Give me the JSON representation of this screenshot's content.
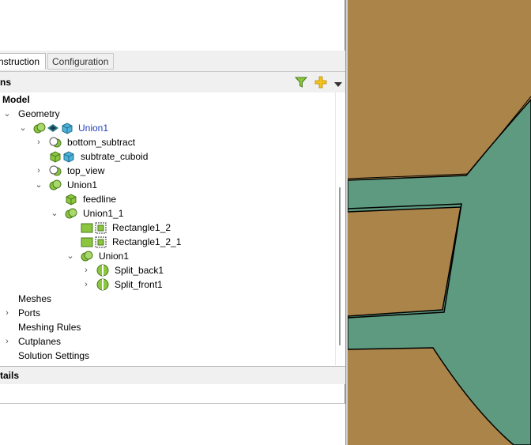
{
  "tabs": [
    {
      "label": "nstruction",
      "active": true
    },
    {
      "label": "Configuration",
      "active": false
    }
  ],
  "tree_header": {
    "label": "ns"
  },
  "tree": {
    "model": "Model",
    "geometry": "Geometry",
    "union1_top": "Union1",
    "bottom_subtract": "bottom_subtract",
    "subtrate_cuboid": "subtrate_cuboid",
    "top_view": "top_view",
    "union1": "Union1",
    "feedline": "feedline",
    "union1_1": "Union1_1",
    "rectangle1_2": "Rectangle1_2",
    "rectangle1_2_1": "Rectangle1_2_1",
    "union1_inner": "Union1",
    "split_back1": "Split_back1",
    "split_front1": "Split_front1",
    "meshes": "Meshes",
    "ports": "Ports",
    "meshing_rules": "Meshing Rules",
    "cutplanes": "Cutplanes",
    "solution_settings": "Solution Settings"
  },
  "details_header": {
    "label": "tails"
  },
  "colors": {
    "substrate": "#ab8449",
    "conductor": "#5e9a80",
    "link_blue": "#1f3fbf",
    "icon_green": "#7fc14f"
  }
}
